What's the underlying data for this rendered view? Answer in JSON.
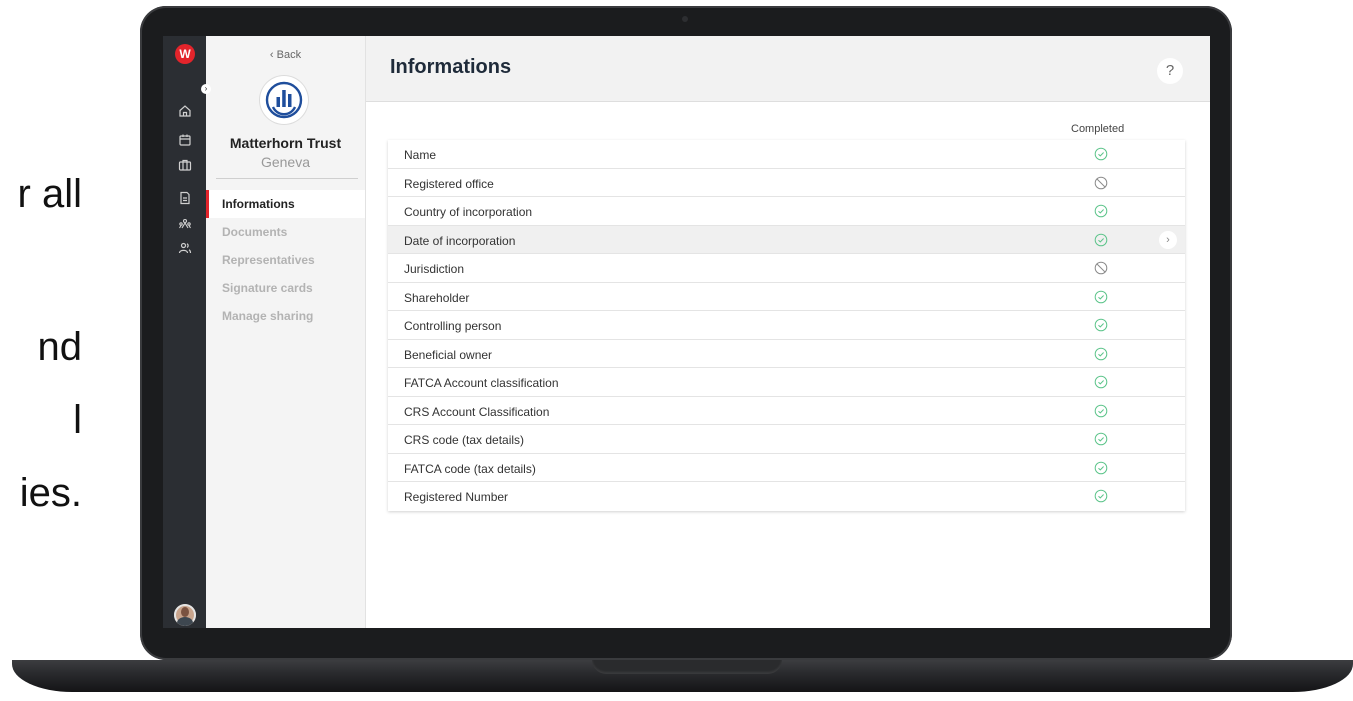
{
  "background_text": {
    "lines": [
      "r all",
      "nd",
      "l",
      "ies."
    ]
  },
  "app": {
    "logo_letter": "W",
    "rail_icons": [
      "home-icon",
      "calendar-icon",
      "briefcase-icon",
      "document-icon",
      "network-icon",
      "users-icon"
    ]
  },
  "sidebar": {
    "back_label": "‹ Back",
    "org_name": "Matterhorn Trust",
    "org_city": "Geneva",
    "nav": [
      {
        "label": "Informations",
        "active": true
      },
      {
        "label": "Documents",
        "active": false
      },
      {
        "label": "Representatives",
        "active": false
      },
      {
        "label": "Signature cards",
        "active": false
      },
      {
        "label": "Manage sharing",
        "active": false
      }
    ]
  },
  "main": {
    "title": "Informations",
    "help_label": "?",
    "column_header": "Completed",
    "rows": [
      {
        "label": "Name",
        "status": "completed"
      },
      {
        "label": "Registered office",
        "status": "not-applicable"
      },
      {
        "label": "Country of incorporation",
        "status": "completed"
      },
      {
        "label": "Date of incorporation",
        "status": "completed",
        "hover": true
      },
      {
        "label": "Jurisdiction",
        "status": "not-applicable"
      },
      {
        "label": "Shareholder",
        "status": "completed"
      },
      {
        "label": "Controlling person",
        "status": "completed"
      },
      {
        "label": "Beneficial owner",
        "status": "completed"
      },
      {
        "label": "FATCA Account classification",
        "status": "completed"
      },
      {
        "label": "CRS Account Classification",
        "status": "completed"
      },
      {
        "label": "CRS code (tax details)",
        "status": "completed"
      },
      {
        "label": "FATCA code (tax details)",
        "status": "completed"
      },
      {
        "label": "Registered Number",
        "status": "completed"
      }
    ]
  },
  "colors": {
    "brand_red": "#e3242b",
    "completed_green": "#5cc48a",
    "na_gray": "#8a8a8a",
    "org_blue": "#1f4e9c"
  }
}
